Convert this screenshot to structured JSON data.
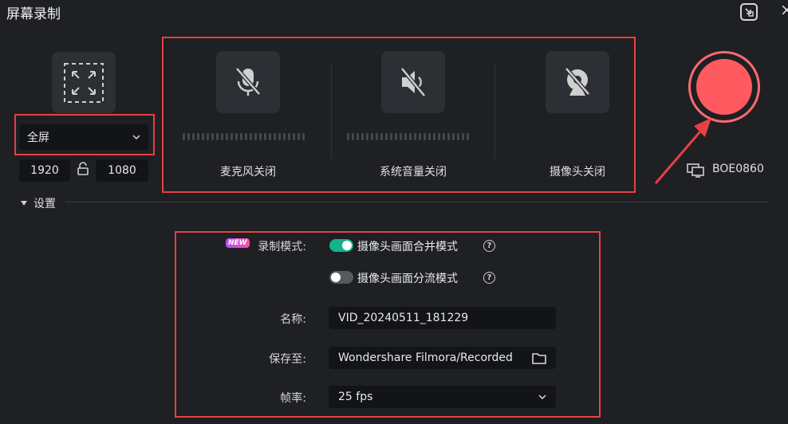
{
  "window": {
    "title": "屏幕录制"
  },
  "area": {
    "mode": "全屏",
    "width": "1920",
    "height": "1080"
  },
  "devices": [
    {
      "label": "麦克风关闭",
      "icon": "mic-off-icon"
    },
    {
      "label": "系统音量关闭",
      "icon": "speaker-off-icon"
    },
    {
      "label": "摄像头关闭",
      "icon": "camera-off-icon"
    }
  ],
  "monitor": {
    "name": "BOE0860",
    "icon": "monitor-icon"
  },
  "settings": {
    "header": "设置",
    "record_mode_label": "录制模式:",
    "new_badge": "NEW",
    "mode_merge": {
      "label": "摄像头画面合并模式",
      "enabled": true
    },
    "mode_split": {
      "label": "摄像头画面分流模式",
      "enabled": false
    },
    "help": "?",
    "name_label": "名称:",
    "name_value": "VID_20240511_181229",
    "save_label": "保存至:",
    "save_value": "Wondershare Filmora/Recorded",
    "fps_label": "帧率:",
    "fps_value": "25 fps"
  },
  "colors": {
    "accent": "#16b38a",
    "record": "#ff5a5f",
    "highlight": "#e64045"
  }
}
